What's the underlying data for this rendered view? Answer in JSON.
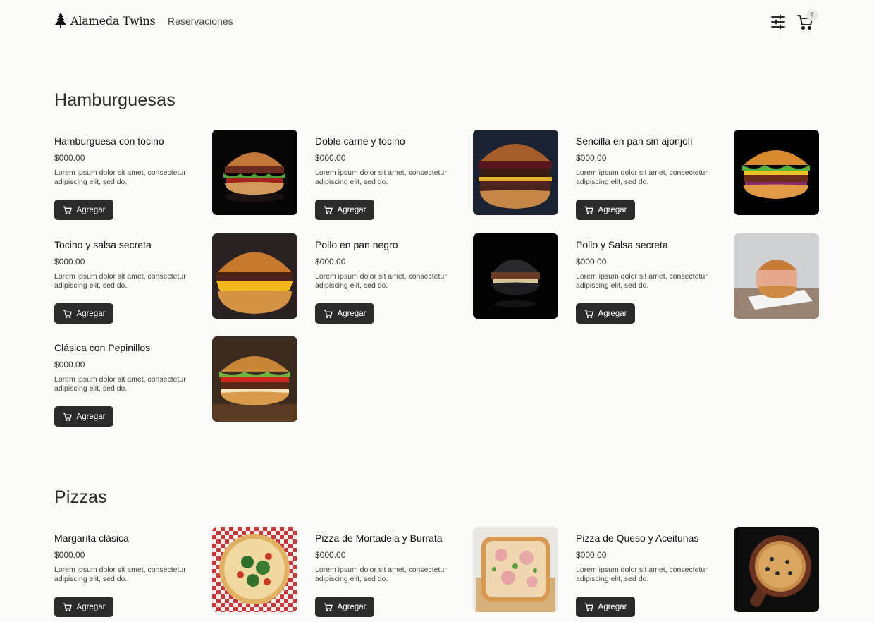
{
  "header": {
    "brand": "Alameda Twins",
    "nav": {
      "reservations": "Reservaciones"
    },
    "cart_count": "4",
    "icons": {
      "logo": "tree-icon",
      "filter": "sliders-icon",
      "cart": "cart-icon"
    }
  },
  "sections": [
    {
      "title": "Hamburguesas",
      "items": [
        {
          "name": "Hamburguesa con tocino",
          "price": "$000.00",
          "description": "Lorem ipsum dolor sit amet, consectetur adipiscing elit, sed do.",
          "button": "Agregar"
        },
        {
          "name": "Doble carne y tocino",
          "price": "$000.00",
          "description": "Lorem ipsum dolor sit amet, consectetur adipiscing elit, sed do.",
          "button": "Agregar"
        },
        {
          "name": "Sencilla en pan sin ajonjolí",
          "price": "$000.00",
          "description": "Lorem ipsum dolor sit amet, consectetur adipiscing elit, sed do.",
          "button": "Agregar"
        },
        {
          "name": "Tocino y salsa secreta",
          "price": "$000.00",
          "description": "Lorem ipsum dolor sit amet, consectetur adipiscing elit, sed do.",
          "button": "Agregar"
        },
        {
          "name": "Pollo en pan negro",
          "price": "$000.00",
          "description": "Lorem ipsum dolor sit amet, consectetur adipiscing elit, sed do.",
          "button": "Agregar"
        },
        {
          "name": "Pollo y Salsa secreta",
          "price": "$000.00",
          "description": "Lorem ipsum dolor sit amet, consectetur adipiscing elit, sed do.",
          "button": "Agregar"
        },
        {
          "name": "Clásica con Pepinillos",
          "price": "$000.00",
          "description": "Lorem ipsum dolor sit amet, consectetur adipiscing elit, sed do.",
          "button": "Agregar"
        }
      ]
    },
    {
      "title": "Pizzas",
      "items": [
        {
          "name": "Margarita clásica",
          "price": "$000.00",
          "description": "Lorem ipsum dolor sit amet, consectetur adipiscing elit, sed do.",
          "button": "Agregar"
        },
        {
          "name": "Pizza de Mortadela y Burrata",
          "price": "$000.00",
          "description": "Lorem ipsum dolor sit amet, consectetur adipiscing elit, sed do.",
          "button": "Agregar"
        },
        {
          "name": "Pizza de Queso y Aceitunas",
          "price": "$000.00",
          "description": "Lorem ipsum dolor sit amet, consectetur adipiscing elit, sed do.",
          "button": "Agregar"
        }
      ]
    }
  ]
}
